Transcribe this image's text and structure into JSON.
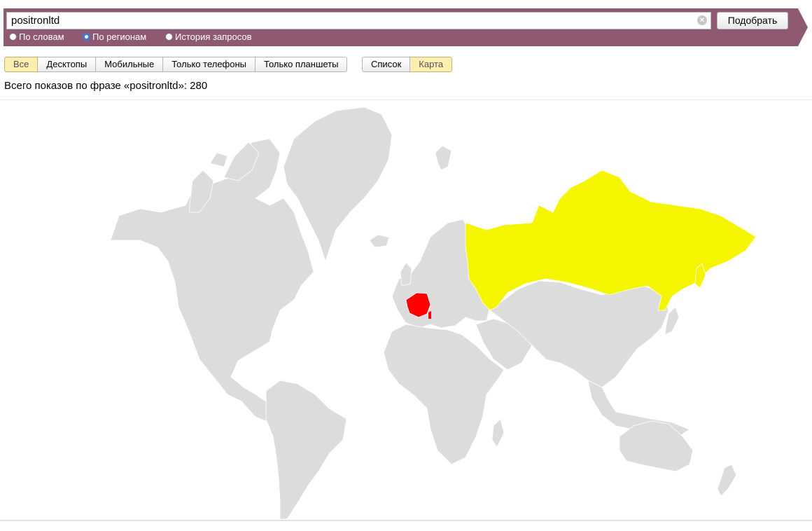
{
  "search": {
    "query": "positronltd",
    "submit_label": "Подобрать",
    "modes": [
      {
        "label": "По словам",
        "selected": false
      },
      {
        "label": "По регионам",
        "selected": true
      },
      {
        "label": "История запросов",
        "selected": false
      }
    ]
  },
  "device_filter": [
    {
      "label": "Все",
      "active": true
    },
    {
      "label": "Десктопы",
      "active": false
    },
    {
      "label": "Мобильные",
      "active": false
    },
    {
      "label": "Только телефоны",
      "active": false
    },
    {
      "label": "Только планшеты",
      "active": false
    }
  ],
  "view_mode": [
    {
      "label": "Список",
      "active": false
    },
    {
      "label": "Карта",
      "active": true
    }
  ],
  "total_text": "Всего показов по фразе «positronltd»: 280",
  "colors": {
    "header": "#8f5a71",
    "land": "#dcdcdc",
    "highlight_high": "#ff0000",
    "highlight_mid": "#f5f500"
  },
  "map": {
    "highlighted_regions": [
      {
        "region": "France",
        "color": "#ff0000"
      },
      {
        "region": "Russia",
        "color": "#f5f500"
      }
    ]
  }
}
